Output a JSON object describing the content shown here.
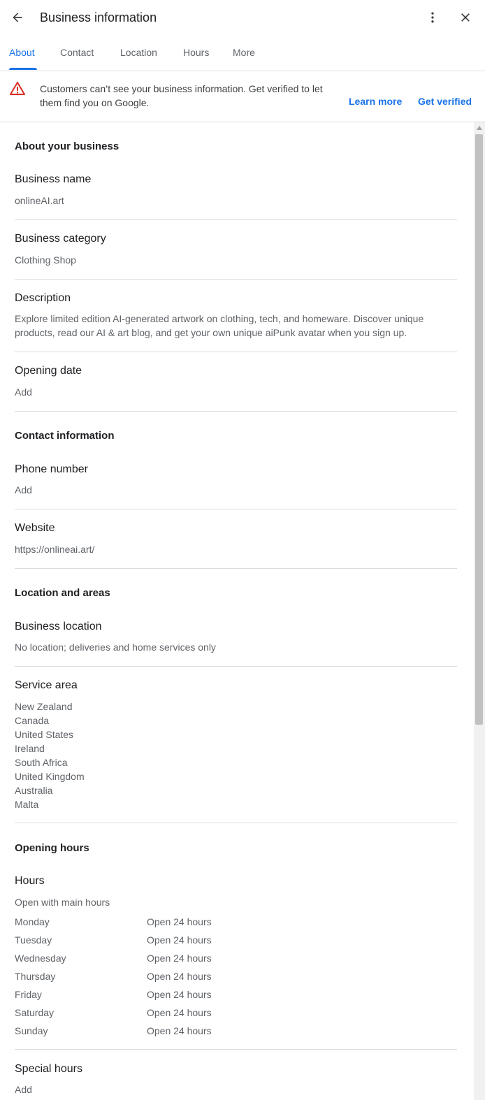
{
  "header": {
    "title": "Business information",
    "back_icon": "arrow-back-icon",
    "more_icon": "more-vert-icon",
    "close_icon": "close-icon"
  },
  "tabs": [
    {
      "label": "About",
      "active": true
    },
    {
      "label": "Contact",
      "active": false
    },
    {
      "label": "Location",
      "active": false
    },
    {
      "label": "Hours",
      "active": false
    },
    {
      "label": "More",
      "active": false
    }
  ],
  "banner": {
    "icon": "warning-icon",
    "text": "Customers can’t see your business information. Get verified to let them find you on Google.",
    "learn_more": "Learn more",
    "get_verified": "Get verified"
  },
  "about": {
    "heading": "About your business",
    "business_name_label": "Business name",
    "business_name_value": "onlineAI.art",
    "category_label": "Business category",
    "category_value": "Clothing Shop",
    "description_label": "Description",
    "description_value": "Explore limited edition AI-generated artwork on clothing, tech, and homeware. Discover unique products, read our AI & art blog, and get your own unique aiPunk avatar when you sign up.",
    "opening_date_label": "Opening date",
    "opening_date_value": "Add"
  },
  "contact": {
    "heading": "Contact information",
    "phone_label": "Phone number",
    "phone_value": "Add",
    "website_label": "Website",
    "website_value": "https://onlineai.art/"
  },
  "location": {
    "heading": "Location and areas",
    "business_location_label": "Business location",
    "business_location_value": "No location; deliveries and home services only",
    "service_area_label": "Service area",
    "service_areas": [
      "New Zealand",
      "Canada",
      "United States",
      "Ireland",
      "South Africa",
      "United Kingdom",
      "Australia",
      "Malta"
    ]
  },
  "opening_hours": {
    "heading": "Opening hours",
    "hours_label": "Hours",
    "hours_status": "Open with main hours",
    "days": [
      {
        "day": "Monday",
        "hours": "Open 24 hours"
      },
      {
        "day": "Tuesday",
        "hours": "Open 24 hours"
      },
      {
        "day": "Wednesday",
        "hours": "Open 24 hours"
      },
      {
        "day": "Thursday",
        "hours": "Open 24 hours"
      },
      {
        "day": "Friday",
        "hours": "Open 24 hours"
      },
      {
        "day": "Saturday",
        "hours": "Open 24 hours"
      },
      {
        "day": "Sunday",
        "hours": "Open 24 hours"
      }
    ],
    "special_hours_label": "Special hours",
    "special_hours_value": "Add"
  },
  "colors": {
    "accent": "#1a73e8",
    "warning": "#d93025",
    "text_primary": "#202124",
    "text_secondary": "#5f6368",
    "divider": "#dadce0"
  }
}
